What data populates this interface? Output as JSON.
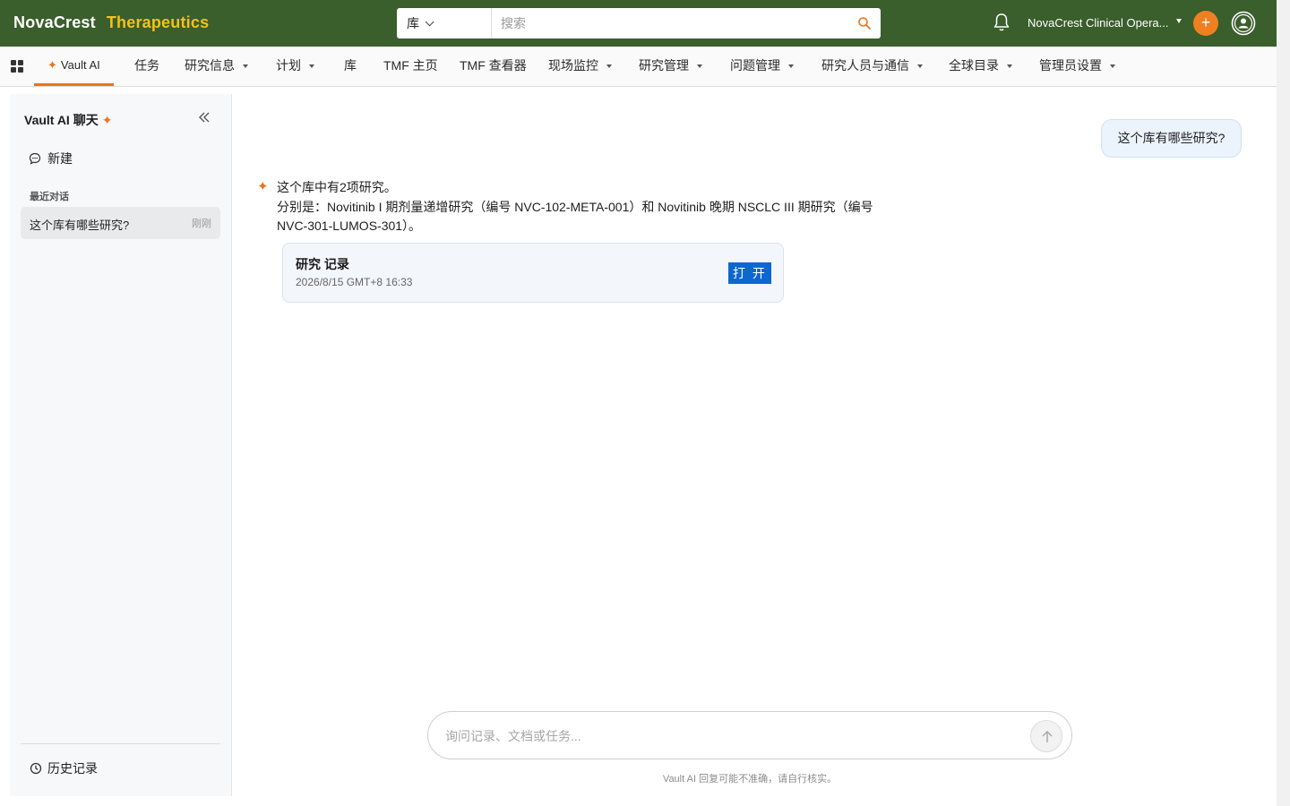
{
  "header": {
    "brand_primary": "NovaCrest",
    "brand_secondary": "Therapeutics",
    "search_scope": "库",
    "search_placeholder": "搜索",
    "org_name": "NovaCrest Clinical Opera...",
    "plus_label": "+"
  },
  "nav": {
    "items": [
      {
        "label": "Vault AI",
        "active": true,
        "dropdown": false
      },
      {
        "label": "任务",
        "dropdown": false
      },
      {
        "label": "研究信息",
        "dropdown": true
      },
      {
        "label": "计划",
        "dropdown": true
      },
      {
        "label": "库",
        "dropdown": false
      },
      {
        "label": "TMF 主页",
        "dropdown": false
      },
      {
        "label": "TMF 查看器",
        "dropdown": false
      },
      {
        "label": "现场监控",
        "dropdown": true
      },
      {
        "label": "研究管理",
        "dropdown": true
      },
      {
        "label": "问题管理",
        "dropdown": true
      },
      {
        "label": "研究人员与通信",
        "dropdown": true
      },
      {
        "label": "全球目录",
        "dropdown": true
      },
      {
        "label": "管理员设置",
        "dropdown": true
      }
    ]
  },
  "sidebar": {
    "title": "Vault AI 聊天",
    "new_label": "新建",
    "recent_heading": "最近对话",
    "conversations": [
      {
        "title": "这个库有哪些研究?",
        "time": "刚刚"
      }
    ],
    "history_label": "历史记录"
  },
  "chat": {
    "user_message": "这个库有哪些研究?",
    "ai_line1": "这个库中有2项研究。",
    "ai_line2": "分别是：Novitinib I 期剂量递增研究（编号 NVC-102-META-001）和 Novitinib 晚期 NSCLC III 期研究（编号 NVC-301-LUMOS-301）。",
    "card": {
      "title": "研究 记录",
      "date": "2026/8/15 GMT+8 16:33",
      "open_label": "打 开"
    },
    "input_placeholder": "询问记录、文档或任务...",
    "disclaimer": "Vault AI 回复可能不准确，请自行核实。"
  },
  "colors": {
    "header_bg": "#3a5e2c",
    "brand_accent": "#f2c21b",
    "ai_accent": "#e8741e",
    "open_button": "#0d67d1"
  }
}
